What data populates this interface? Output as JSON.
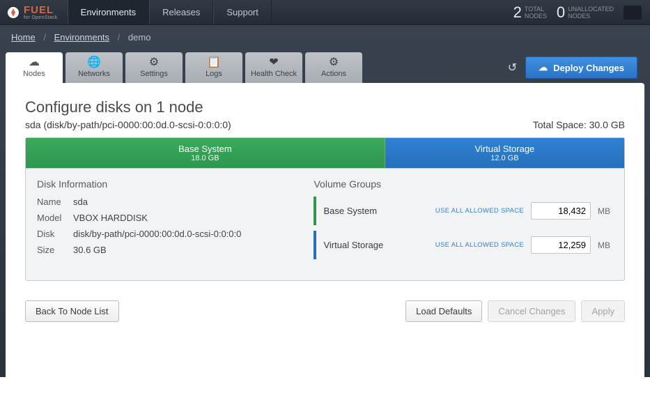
{
  "brand": {
    "name": "FUEL",
    "sub": "for OpenStack"
  },
  "nav": {
    "items": [
      "Environments",
      "Releases",
      "Support"
    ],
    "active": 0
  },
  "stats": {
    "total": {
      "num": "2",
      "l1": "TOTAL",
      "l2": "NODES"
    },
    "unalloc": {
      "num": "0",
      "l1": "UNALLOCATED",
      "l2": "NODES"
    }
  },
  "breadcrumb": {
    "a": "Home",
    "b": "Environments",
    "c": "demo",
    "sep": "/"
  },
  "tabs": [
    {
      "label": "Nodes",
      "icon": "☁"
    },
    {
      "label": "Networks",
      "icon": "🌐"
    },
    {
      "label": "Settings",
      "icon": "⚙"
    },
    {
      "label": "Logs",
      "icon": "📋"
    },
    {
      "label": "Health Check",
      "icon": "❤"
    },
    {
      "label": "Actions",
      "icon": "⚙"
    }
  ],
  "deploy": {
    "label": "Deploy Changes"
  },
  "page": {
    "title": "Configure disks on 1 node",
    "device": "sda (disk/by-path/pci-0000:00:0d.0-scsi-0:0:0:0)",
    "total": "Total Space: 30.0 GB"
  },
  "segments": {
    "base": {
      "name": "Base System",
      "size": "18.0 GB"
    },
    "vs": {
      "name": "Virtual Storage",
      "size": "12.0 GB"
    }
  },
  "diskinfo": {
    "title": "Disk Information",
    "rows": {
      "name": {
        "label": "Name",
        "value": "sda"
      },
      "model": {
        "label": "Model",
        "value": "VBOX HARDDISK"
      },
      "disk": {
        "label": "Disk",
        "value": "disk/by-path/pci-0000:00:0d.0-scsi-0:0:0:0"
      },
      "size": {
        "label": "Size",
        "value": "30.6 GB"
      }
    }
  },
  "volgroups": {
    "title": "Volume Groups",
    "link": "USE ALL ALLOWED SPACE",
    "unit": "MB",
    "base": {
      "name": "Base System",
      "value": "18,432"
    },
    "vs": {
      "name": "Virtual Storage",
      "value": "12,259"
    }
  },
  "buttons": {
    "back": "Back To Node List",
    "defaults": "Load Defaults",
    "cancel": "Cancel Changes",
    "apply": "Apply"
  }
}
